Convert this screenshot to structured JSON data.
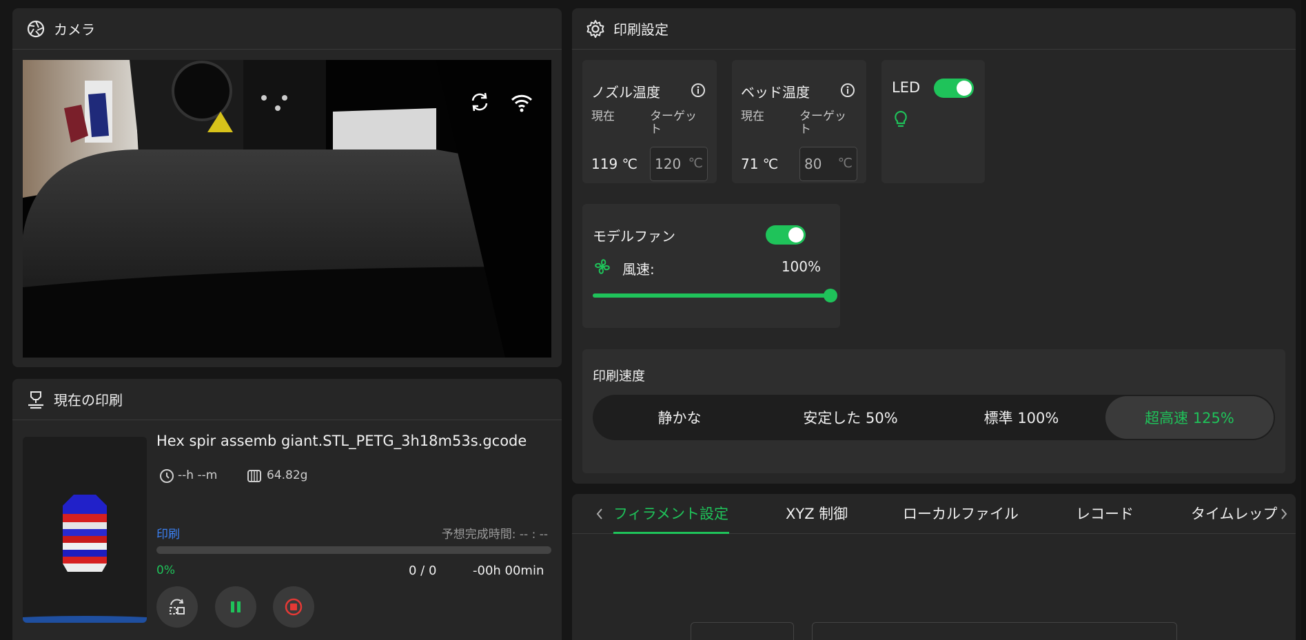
{
  "camera": {
    "title": "カメラ",
    "refresh_icon": "refresh-icon",
    "wifi_icon": "wifi-icon"
  },
  "current_print": {
    "title": "現在の印刷",
    "filename": "Hex spir assemb giant.STL_PETG_3h18m53s.gcode",
    "time": "--h --m",
    "weight": "64.82g",
    "status": "印刷",
    "eta_label": "予想完成時間: -- : --",
    "progress_text": "0%",
    "progress": 0,
    "layers": "0 / 0",
    "remaining": "-00h 00min"
  },
  "settings": {
    "title": "印刷設定",
    "nozzle": {
      "title": "ノズル温度",
      "current_label": "現在",
      "target_label": "ターゲット",
      "current_value": "119 ℃",
      "target_value": "120",
      "unit": "℃"
    },
    "bed": {
      "title": "ベッド温度",
      "current_label": "現在",
      "target_label": "ターゲット",
      "current_value": "71 ℃",
      "target_value": "80",
      "unit": "℃"
    },
    "led": {
      "label": "LED",
      "on": true
    },
    "fan": {
      "title": "モデルファン",
      "speed_label": "風速:",
      "speed_value": "100%",
      "level": 100,
      "on": true
    },
    "print_speed": {
      "title": "印刷速度",
      "options": [
        "静かな",
        "安定した 50%",
        "標準 100%",
        "超高速 125%"
      ],
      "selected": 3
    }
  },
  "tabs": {
    "items": [
      "フィラメント設定",
      "XYZ 制御",
      "ローカルファイル",
      "レコード",
      "タイムレップ"
    ],
    "active": 0
  },
  "colors": {
    "accent": "#1fc35a",
    "link": "#3b82f6",
    "stop": "#e53935"
  }
}
